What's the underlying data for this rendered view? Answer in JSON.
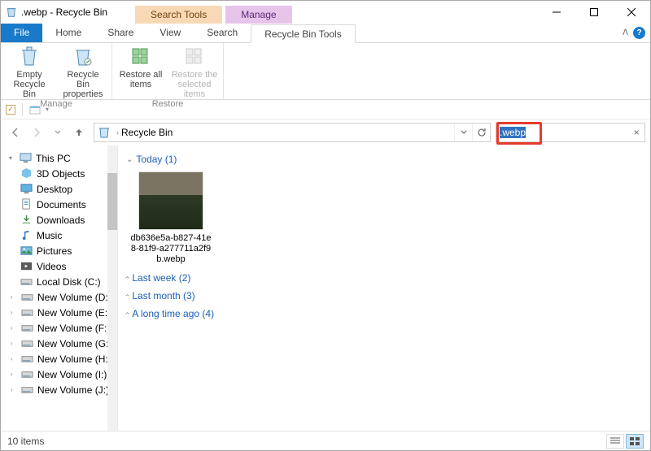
{
  "window": {
    "title": ".webp - Recycle Bin"
  },
  "contextTabs": {
    "search": "Search Tools",
    "manage": "Manage"
  },
  "ribbonTabs": {
    "file": "File",
    "home": "Home",
    "share": "Share",
    "view": "View",
    "search": "Search",
    "rbtools": "Recycle Bin Tools"
  },
  "ribbon": {
    "manageGroup": "Manage",
    "restoreGroup": "Restore",
    "emptyBin": "Empty Recycle Bin",
    "rbProps": "Recycle Bin properties",
    "restoreAll": "Restore all items",
    "restoreSel": "Restore the selected items"
  },
  "address": {
    "location": "Recycle Bin"
  },
  "search": {
    "value": ".webp"
  },
  "tree": {
    "thisPC": "This PC",
    "objects3d": "3D Objects",
    "desktop": "Desktop",
    "documents": "Documents",
    "downloads": "Downloads",
    "music": "Music",
    "pictures": "Pictures",
    "videos": "Videos",
    "localC": "Local Disk (C:)",
    "newD": "New Volume (D:)",
    "newE": "New Volume (E:)",
    "newF": "New Volume (F:)",
    "newG": "New Volume (G:)",
    "newH": "New Volume (H:)",
    "newI": "New Volume (I:)",
    "newJ": "New Volume (J:)"
  },
  "groups": {
    "today": "Today (1)",
    "lastWeek": "Last week (2)",
    "lastMonth": "Last month (3)",
    "longAgo": "A long time ago (4)"
  },
  "file": {
    "name": "db636e5a-b827-41e8-81f9-a277711a2f9b.webp"
  },
  "status": {
    "count": "10 items"
  }
}
